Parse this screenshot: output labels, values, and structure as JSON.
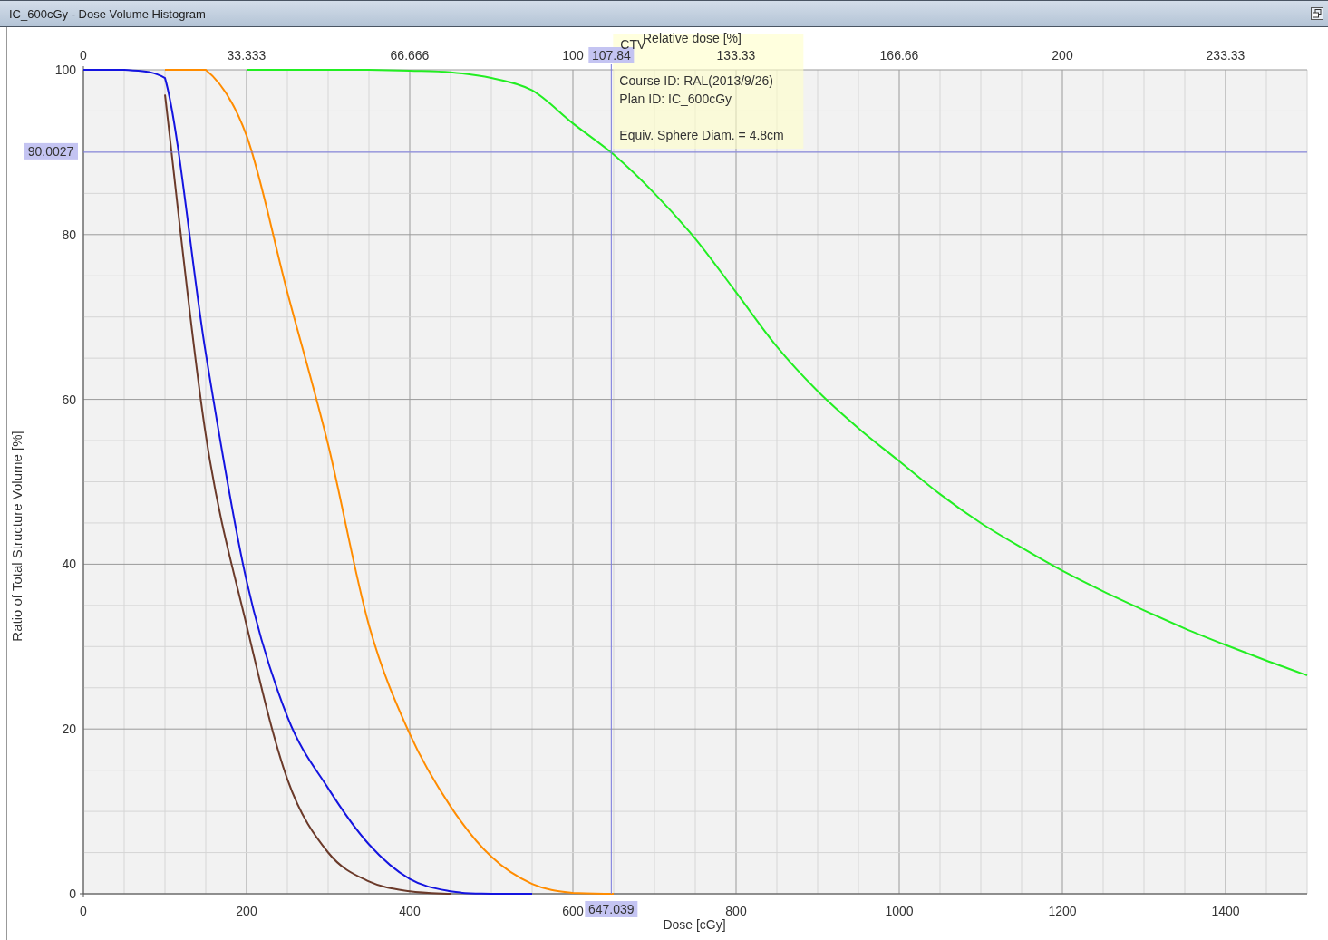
{
  "window": {
    "title": "IC_600cGy - Dose Volume Histogram"
  },
  "chart": {
    "chart_data": {
      "type": "line",
      "xlabel": "Dose [cGy]",
      "ylabel": "Ratio of Total Structure Volume [%]",
      "xlim": [
        0,
        1500
      ],
      "ylim": [
        0,
        100
      ],
      "xticks": [
        0,
        200,
        400,
        600,
        800,
        1000,
        1200,
        1400
      ],
      "yticks": [
        0,
        20,
        40,
        60,
        80,
        100
      ],
      "grid": true,
      "ref_lines": [
        {
          "axis": "x",
          "value": 647.039,
          "color": "#7777dd"
        },
        {
          "axis": "y",
          "value": 90.0027,
          "color": "#7777dd"
        }
      ],
      "x": [
        0,
        50,
        100,
        150,
        200,
        250,
        300,
        350,
        400,
        450,
        500,
        550,
        600,
        650,
        700,
        750,
        800,
        850,
        900,
        950,
        1000,
        1050,
        1100,
        1150,
        1200,
        1250,
        1300,
        1350,
        1400,
        1450,
        1500
      ],
      "series": [
        {
          "color": "#22ee22",
          "values": [
            null,
            null,
            null,
            null,
            100,
            100,
            100,
            100,
            99.9,
            99.7,
            99,
            97.5,
            93.5,
            89.7,
            85,
            79.5,
            73,
            66.4,
            61,
            56.5,
            52.5,
            48.5,
            45,
            42,
            39.2,
            36.7,
            34.4,
            32.2,
            30.2,
            28.3,
            26.5
          ]
        },
        {
          "color": "#ff8c00",
          "values": [
            null,
            null,
            100,
            100,
            92,
            73,
            54.5,
            32.6,
            19.4,
            10.6,
            4.5,
            1.2,
            0.1,
            0,
            null,
            null,
            null,
            null,
            null,
            null,
            null,
            null,
            null,
            null,
            null,
            null,
            null,
            null,
            null,
            null,
            null
          ]
        },
        {
          "color": "#6b3a2a",
          "values": [
            null,
            null,
            97,
            55.7,
            32.6,
            13.9,
            5,
            1.5,
            0.3,
            0,
            null,
            null,
            null,
            null,
            null,
            null,
            null,
            null,
            null,
            null,
            null,
            null,
            null,
            null,
            null,
            null,
            null,
            null,
            null,
            null,
            null
          ]
        },
        {
          "color": "#1414e0",
          "values": [
            100,
            100,
            99,
            65.6,
            38,
            21.5,
            12.8,
            6,
            1.8,
            0.3,
            0,
            0,
            null,
            null,
            null,
            null,
            null,
            null,
            null,
            null,
            null,
            null,
            null,
            null,
            null,
            null,
            null,
            null,
            null,
            null,
            null
          ]
        }
      ]
    },
    "top_axis": {
      "label": "Relative dose [%]",
      "ticks": [
        "0",
        "33.333",
        "66.666",
        "100",
        "133.33",
        "166.66",
        "200",
        "233.33"
      ]
    },
    "cursor": {
      "dose_readout": "647.039",
      "relative_readout": "107.84",
      "volume_readout": "90.0027"
    },
    "tooltip": {
      "structure": "CTV",
      "lines": [
        "Course ID: RAL(2013/9/26)",
        "Plan ID: IC_600cGy"
      ],
      "detail": "Equiv. Sphere Diam. = 4.8cm"
    }
  }
}
